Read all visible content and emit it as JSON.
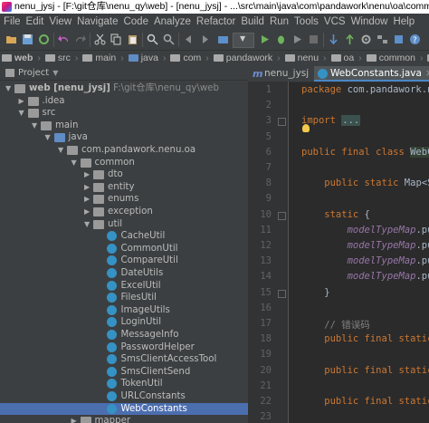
{
  "window": {
    "title": "nenu_jysj - [F:\\git仓库\\nenu_qy\\web] - [nenu_jysj] - ...\\src\\main\\java\\com\\pandawork\\nenu\\oa\\common\\util\\WebConstants.java - IntelliJ IDEA"
  },
  "menu": [
    "File",
    "Edit",
    "View",
    "Navigate",
    "Code",
    "Analyze",
    "Refactor",
    "Build",
    "Run",
    "Tools",
    "VCS",
    "Window",
    "Help"
  ],
  "breadcrumbs": [
    "web",
    "src",
    "main",
    "java",
    "com",
    "pandawork",
    "nenu",
    "oa",
    "common",
    "util",
    "We"
  ],
  "project_panel": {
    "header": "Project",
    "tree": [
      {
        "label": "web [nenu_jysj]",
        "hint": "F:\\git仓库\\nenu_qy\\web",
        "depth": 0,
        "arrow": "open",
        "icon": "folder"
      },
      {
        "label": ".idea",
        "depth": 1,
        "arrow": "closed",
        "icon": "folder"
      },
      {
        "label": "src",
        "depth": 1,
        "arrow": "open",
        "icon": "folder"
      },
      {
        "label": "main",
        "depth": 2,
        "arrow": "open",
        "icon": "folder"
      },
      {
        "label": "java",
        "depth": 3,
        "arrow": "open",
        "icon": "src-folder"
      },
      {
        "label": "com.pandawork.nenu.oa",
        "depth": 4,
        "arrow": "open",
        "icon": "package"
      },
      {
        "label": "common",
        "depth": 5,
        "arrow": "open",
        "icon": "package"
      },
      {
        "label": "dto",
        "depth": 6,
        "arrow": "closed",
        "icon": "package"
      },
      {
        "label": "entity",
        "depth": 6,
        "arrow": "closed",
        "icon": "package"
      },
      {
        "label": "enums",
        "depth": 6,
        "arrow": "closed",
        "icon": "package"
      },
      {
        "label": "exception",
        "depth": 6,
        "arrow": "closed",
        "icon": "package"
      },
      {
        "label": "util",
        "depth": 6,
        "arrow": "open",
        "icon": "package"
      },
      {
        "label": "CacheUtil",
        "depth": 7,
        "arrow": "none",
        "icon": "class"
      },
      {
        "label": "CommonUtil",
        "depth": 7,
        "arrow": "none",
        "icon": "class"
      },
      {
        "label": "CompareUtil",
        "depth": 7,
        "arrow": "none",
        "icon": "class"
      },
      {
        "label": "DateUtils",
        "depth": 7,
        "arrow": "none",
        "icon": "class"
      },
      {
        "label": "ExcelUtil",
        "depth": 7,
        "arrow": "none",
        "icon": "class"
      },
      {
        "label": "FilesUtil",
        "depth": 7,
        "arrow": "none",
        "icon": "class"
      },
      {
        "label": "ImageUtils",
        "depth": 7,
        "arrow": "none",
        "icon": "class"
      },
      {
        "label": "LoginUtil",
        "depth": 7,
        "arrow": "none",
        "icon": "class"
      },
      {
        "label": "MessageInfo",
        "depth": 7,
        "arrow": "none",
        "icon": "class"
      },
      {
        "label": "PasswordHelper",
        "depth": 7,
        "arrow": "none",
        "icon": "class"
      },
      {
        "label": "SmsClientAccessTool",
        "depth": 7,
        "arrow": "none",
        "icon": "class"
      },
      {
        "label": "SmsClientSend",
        "depth": 7,
        "arrow": "none",
        "icon": "class"
      },
      {
        "label": "TokenUtil",
        "depth": 7,
        "arrow": "none",
        "icon": "class"
      },
      {
        "label": "URLConstants",
        "depth": 7,
        "arrow": "none",
        "icon": "class"
      },
      {
        "label": "WebConstants",
        "depth": 7,
        "arrow": "none",
        "icon": "class",
        "selected": true
      },
      {
        "label": "mapper",
        "depth": 5,
        "arrow": "closed",
        "icon": "package"
      }
    ]
  },
  "editor": {
    "tabs": [
      {
        "label": "nenu_jysj",
        "icon": "m",
        "active": false
      },
      {
        "label": "WebConstants.java",
        "icon": "class",
        "active": true,
        "close": "×"
      }
    ],
    "lines": [
      {
        "n": "1",
        "tokens": [
          {
            "t": "package ",
            "c": "kw"
          },
          {
            "t": "com.pandawork.nenu",
            "c": "pl"
          }
        ]
      },
      {
        "n": "2",
        "tokens": []
      },
      {
        "n": "3",
        "tokens": [
          {
            "t": "import ",
            "c": "kw"
          },
          {
            "t": "...",
            "c": "fold"
          }
        ]
      },
      {
        "n": "5",
        "tokens": []
      },
      {
        "n": "6",
        "tokens": [
          {
            "t": "public final class ",
            "c": "kw"
          },
          {
            "t": "WebCo",
            "c": "hlpl"
          }
        ]
      },
      {
        "n": "7",
        "tokens": []
      },
      {
        "n": "8",
        "tokens": [
          {
            "t": "    public static ",
            "c": "kw"
          },
          {
            "t": "Map<Str",
            "c": "pl"
          }
        ]
      },
      {
        "n": "9",
        "tokens": []
      },
      {
        "n": "10",
        "tokens": [
          {
            "t": "    static ",
            "c": "kw"
          },
          {
            "t": "{",
            "c": "pl"
          }
        ]
      },
      {
        "n": "11",
        "tokens": [
          {
            "t": "        ",
            "c": "pl"
          },
          {
            "t": "modelTypeMap",
            "c": "ital"
          },
          {
            "t": ".put",
            "c": "pl"
          }
        ]
      },
      {
        "n": "12",
        "tokens": [
          {
            "t": "        ",
            "c": "pl"
          },
          {
            "t": "modelTypeMap",
            "c": "ital"
          },
          {
            "t": ".put",
            "c": "pl"
          }
        ]
      },
      {
        "n": "13",
        "tokens": [
          {
            "t": "        ",
            "c": "pl"
          },
          {
            "t": "modelTypeMap",
            "c": "ital"
          },
          {
            "t": ".put",
            "c": "pl"
          }
        ]
      },
      {
        "n": "14",
        "tokens": [
          {
            "t": "        ",
            "c": "pl"
          },
          {
            "t": "modelTypeMap",
            "c": "ital"
          },
          {
            "t": ".put",
            "c": "pl"
          }
        ]
      },
      {
        "n": "15",
        "tokens": [
          {
            "t": "    }",
            "c": "pl"
          }
        ]
      },
      {
        "n": "16",
        "tokens": []
      },
      {
        "n": "17",
        "tokens": [
          {
            "t": "    // 错误码",
            "c": "cm"
          }
        ]
      },
      {
        "n": "18",
        "tokens": [
          {
            "t": "    public final static ",
            "c": "kw"
          }
        ]
      },
      {
        "n": "19",
        "tokens": []
      },
      {
        "n": "20",
        "tokens": [
          {
            "t": "    public final static ",
            "c": "kw"
          }
        ]
      },
      {
        "n": "21",
        "tokens": []
      },
      {
        "n": "22",
        "tokens": [
          {
            "t": "    public final static ",
            "c": "kw"
          }
        ]
      },
      {
        "n": "23",
        "tokens": []
      }
    ]
  },
  "colors": {
    "background": "#2b2b2b",
    "panel": "#3c3f41",
    "selection": "#4b6eaf",
    "keyword": "#cc7832",
    "field": "#9876aa",
    "comment": "#808080"
  }
}
